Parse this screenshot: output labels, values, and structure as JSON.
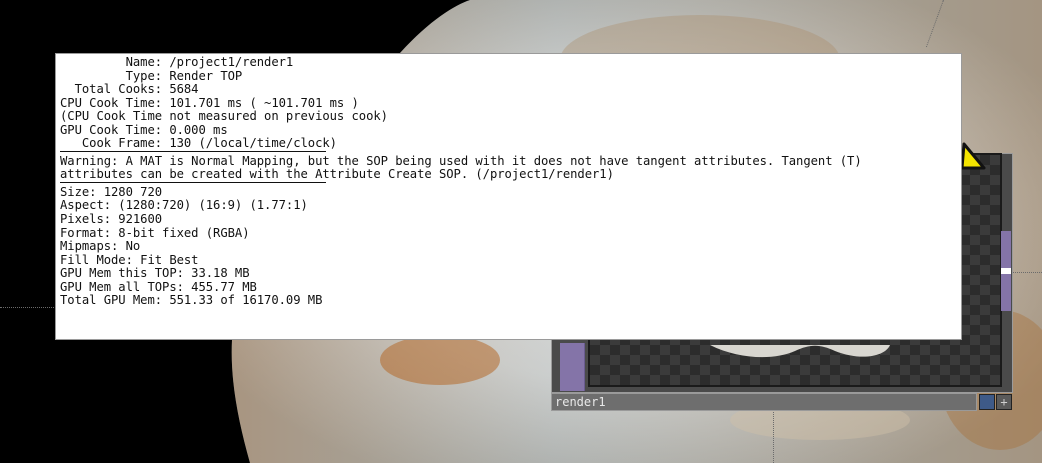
{
  "info": {
    "name_line": "         Name: /project1/render1",
    "type_line": "         Type: Render TOP",
    "total_cooks_line": "  Total Cooks: 5684",
    "cpu_cook_line": "CPU Cook Time: 101.701 ms ( ~101.701 ms )",
    "cpu_note_line": "(CPU Cook Time not measured on previous cook)",
    "gpu_cook_line": "GPU Cook Time: 0.000 ms",
    "cook_frame_line": "   Cook Frame: 130 (/local/time/clock)",
    "warning_line_1": "Warning: A MAT is Normal Mapping, but the SOP being used with it does not have tangent attributes. Tangent (T)",
    "warning_line_2": "attributes can be created with the Attribute Create SOP. (/project1/render1)",
    "size_line": "Size: 1280 720",
    "aspect_line": "Aspect: (1280:720) (16:9) (1.77:1)",
    "pixels_line": "Pixels: 921600",
    "format_line": "Format: 8-bit fixed (RGBA)",
    "mipmaps_line": "Mipmaps: No",
    "fill_mode_line": "Fill Mode: Fit Best",
    "gpu_mem_this_line": "GPU Mem this TOP: 33.18 MB",
    "gpu_mem_all_line": "GPU Mem all TOPs: 455.77 MB",
    "total_gpu_mem_line": "Total GPU Mem: 551.33 of 16170.09 MB"
  },
  "node": {
    "title": "render1",
    "button_b": "+"
  },
  "icons": {
    "warning": "warning-icon"
  },
  "colors": {
    "node_accent": "#8474a8",
    "warning_yellow": "#f2e300",
    "panel_bg": "#ffffff"
  }
}
